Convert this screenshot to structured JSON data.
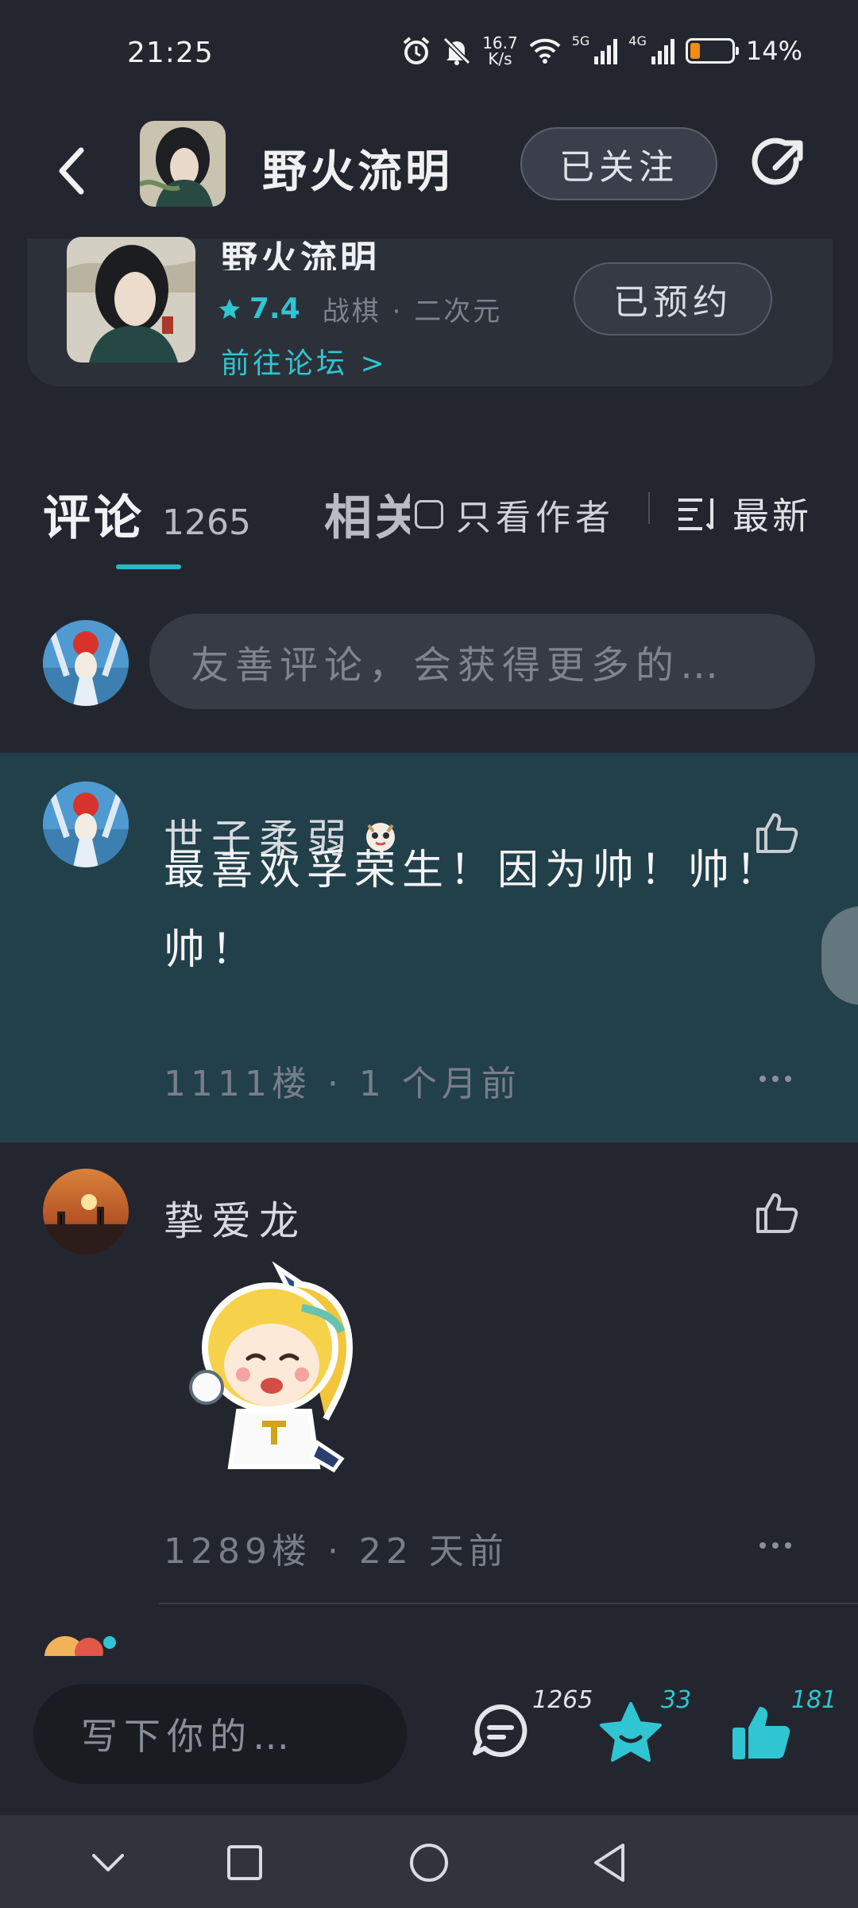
{
  "status_bar": {
    "time": "21:25",
    "speed_value": "16.7",
    "speed_unit": "K/s",
    "net_5g": "5G",
    "net_4g": "4G",
    "battery_percent": 0.14,
    "battery_text": "14%"
  },
  "header": {
    "title": "野火流明",
    "follow_label": "已关注"
  },
  "game_card": {
    "name": "野火流明",
    "rating": "7.4",
    "tags": "战棋 · 二次元",
    "forum_link": "前往论坛 >",
    "reserve_label": "已预约"
  },
  "tabs": {
    "comments_label": "评论",
    "comments_count": "1265",
    "related_label": "相关",
    "author_only_label": "只看作者",
    "sort_label": "最新"
  },
  "comment_input": {
    "placeholder": "友善评论，会获得更多的…"
  },
  "comments": [
    {
      "username": "世子柔弱",
      "text": "最喜欢孚荣生！因为帅！帅！帅！",
      "meta": "1111楼 · 1 个月前"
    },
    {
      "username": "挚爱龙",
      "meta": "1289楼 · 22 天前"
    }
  ],
  "action_bar": {
    "reply_placeholder": "写下你的…",
    "comment_count": "1265",
    "favorite_count": "33",
    "like_count": "181"
  },
  "colors": {
    "accent": "#2fc5d2",
    "background": "#24262f",
    "highlight_row": "#22404a",
    "battery_low": "#f38b14"
  },
  "icons": [
    "back-arrow-icon",
    "share-icon",
    "star-icon",
    "checkbox-icon",
    "sort-icon",
    "thumbs-up-icon",
    "more-icon",
    "comment-icon",
    "favorite-star-icon",
    "like-icon",
    "nav-down-icon",
    "nav-recents-icon",
    "nav-home-icon",
    "nav-back-icon"
  ]
}
